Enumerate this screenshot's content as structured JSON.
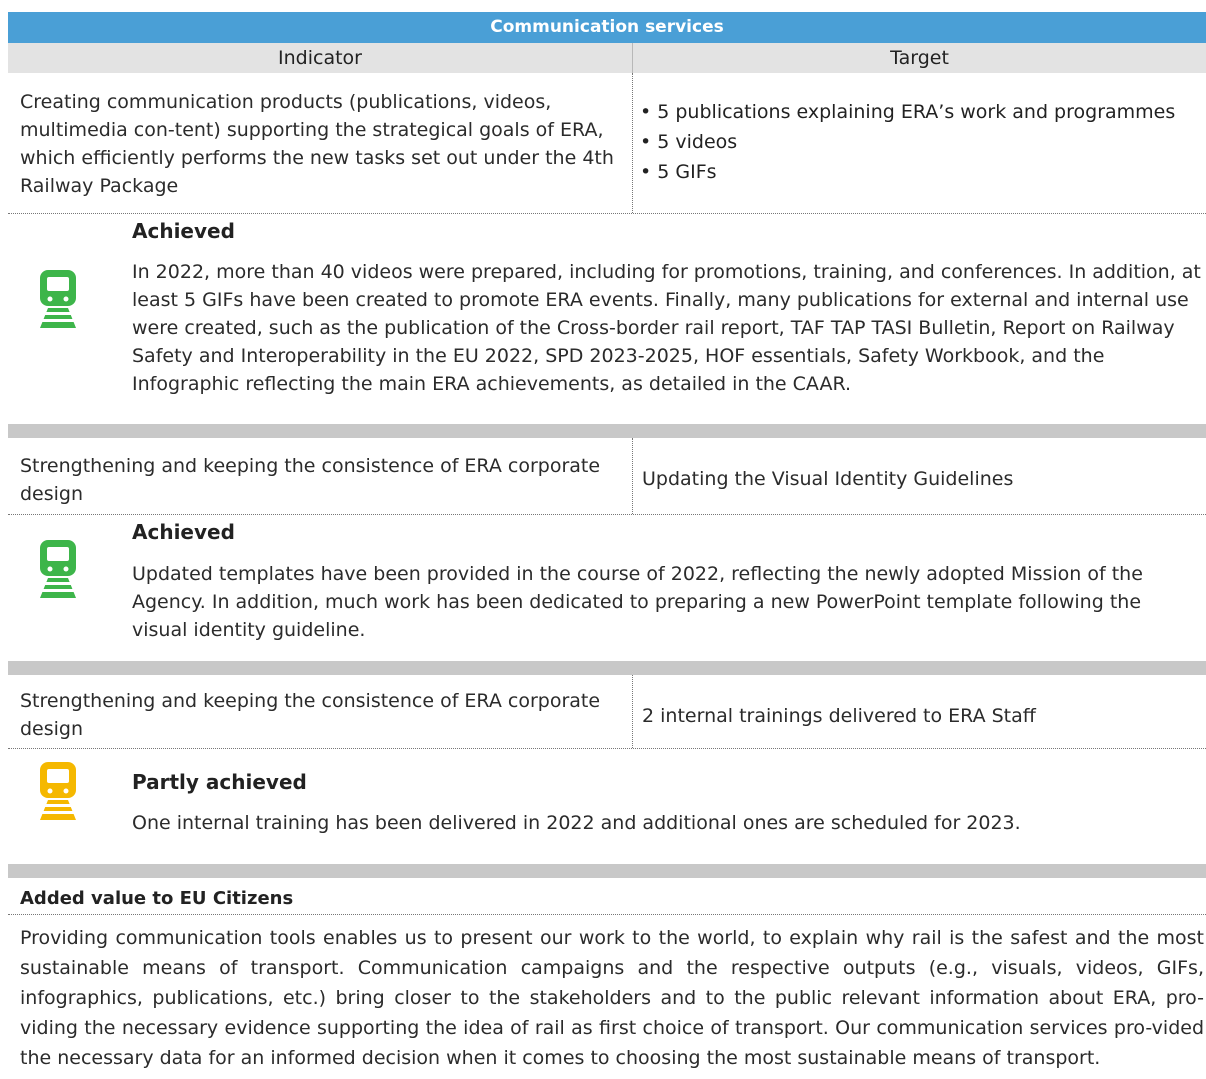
{
  "title": "Communication services",
  "headers": {
    "indicator": "Indicator",
    "target": "Target"
  },
  "blocks": [
    {
      "indicator": "Creating communication products (publications, videos, multimedia con-tent) supporting the strategical goals of ERA, which efficiently performs the new tasks set out under the 4th Railway Package",
      "targets": [
        "• 5 publications explaining ERA’s work and programmes",
        "• 5 videos",
        "• 5 GIFs"
      ],
      "status": "Achieved",
      "status_color": "#3db54a",
      "status_icon": "train-icon",
      "description": "In 2022, more than 40 videos were prepared, including for promotions, training, and conferences. In addition, at least 5 GIFs have been created to promote ERA events. Finally, many publications for external and internal use were created, such as the publication of the Cross-border rail report, TAF TAP TASI Bulletin, Report on Railway Safety and Interoperability in the EU 2022, SPD 2023-2025, HOF essentials, Safety Workbook, and the Infographic reflecting the main ERA achievements, as detailed in the CAAR."
    },
    {
      "indicator": "Strengthening and keeping the consistence of ERA corporate design",
      "target": "Updating the Visual Identity Guidelines",
      "status": "Achieved",
      "status_color": "#3db54a",
      "status_icon": "train-icon",
      "description": "Updated templates have been provided in the course of 2022, reflecting the newly adopted Mission of the Agency. In addition, much work has been dedicated to preparing a new PowerPoint template following the visual identity guideline."
    },
    {
      "indicator": "Strengthening and keeping the consistence of ERA corporate design",
      "target": "2 internal trainings delivered to ERA Staff",
      "status": "Partly achieved",
      "status_color": "#f5b800",
      "status_icon": "train-icon",
      "description": "One internal training has been delivered in 2022 and additional ones are scheduled for 2023."
    }
  ],
  "added_value": {
    "heading": "Added value to EU Citizens",
    "text": "Providing communication tools enables us to present our work to the world, to explain why rail is the safest and the most sustainable means of transport. Communication campaigns and the respective outputs (e.g., visuals, videos, GIFs, infographics, publications, etc.) bring closer to the stakeholders and to the public relevant information about ERA, pro-viding the necessary evidence supporting the idea of rail as first choice of transport. Our communication services pro-vided the necessary data for an informed decision when it comes to choosing the most sustainable means of transport."
  }
}
